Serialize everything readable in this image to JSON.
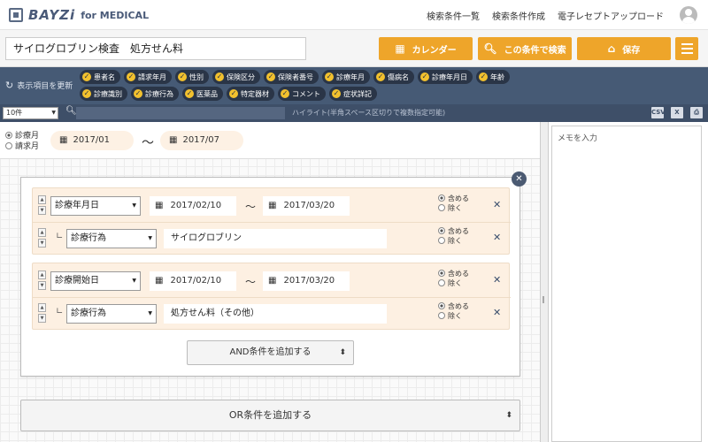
{
  "app": {
    "brand": "BAYZi",
    "brand_sub": "for MEDICAL"
  },
  "topnav": [
    {
      "label": "検索条件一覧"
    },
    {
      "label": "検索条件作成"
    },
    {
      "label": "電子レセプトアップロード"
    }
  ],
  "titlebar": {
    "title": "サイログロブリン検査　処方せん料",
    "calendar_label": "カレンダー",
    "search_label": "この条件で検索",
    "save_label": "保存"
  },
  "tagbar": {
    "refresh_label": "表示項目を更新",
    "tags": [
      "患者名",
      "請求年月",
      "性別",
      "保険区分",
      "保険者番号",
      "診療年月",
      "傷病名",
      "診療年月日",
      "年齢",
      "診療識別",
      "診療行為",
      "医薬品",
      "特定器材",
      "コメント",
      "症状詳記"
    ]
  },
  "searchbar": {
    "per_page": "10件",
    "hint": "ハイライト(半角スペース区切りで複数指定可能)",
    "csv_label": "CSV",
    "excel_label": "X"
  },
  "daterange": {
    "radio_options": [
      "診療月",
      "請求月"
    ],
    "from": "2017/01",
    "to": "2017/07",
    "tilde": "〜"
  },
  "memo": {
    "placeholder": "メモを入力"
  },
  "groups": [
    {
      "field": "診療年月日",
      "from": "2017/02/10",
      "to": "2017/03/20",
      "sub_field": "診療行為",
      "sub_value": "サイログロブリン"
    },
    {
      "field": "診療開始日",
      "from": "2017/02/10",
      "to": "2017/03/20",
      "sub_field": "診療行為",
      "sub_value": "処方せん料（その他）"
    }
  ],
  "include_options": {
    "include": "含める",
    "exclude": "除く"
  },
  "buttons": {
    "and_label": "AND条件を追加する",
    "or_label": "OR条件を追加する"
  }
}
